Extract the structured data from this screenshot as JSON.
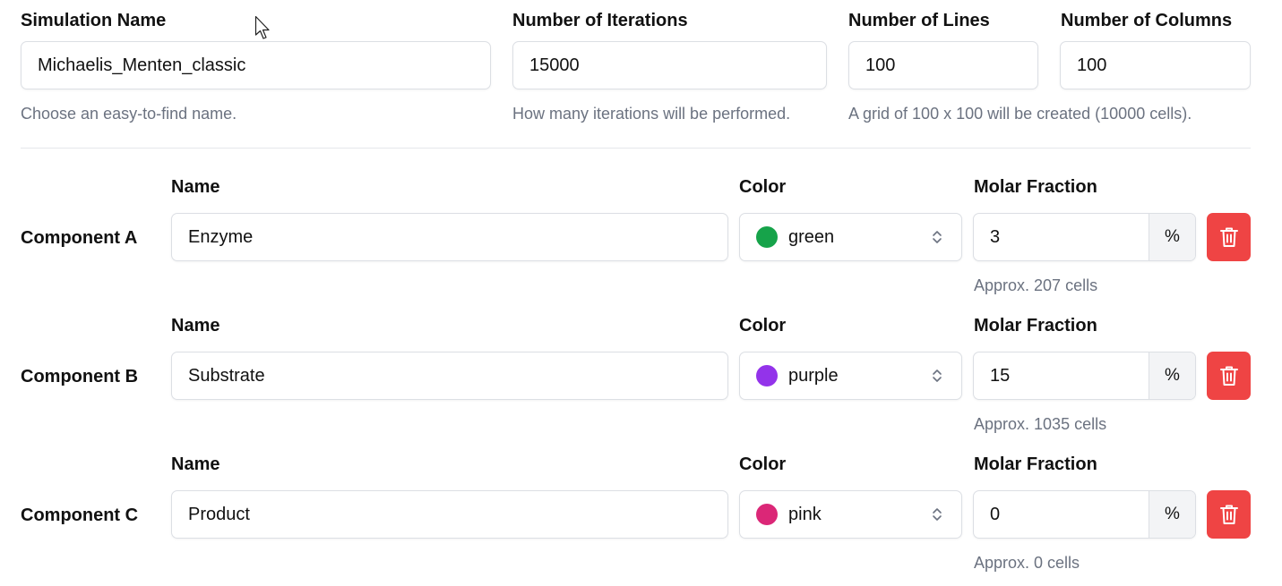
{
  "settings": {
    "simulation_name": {
      "label": "Simulation Name",
      "value": "Michaelis_Menten_classic",
      "help": "Choose an easy-to-find name."
    },
    "iterations": {
      "label": "Number of Iterations",
      "value": "15000",
      "help": "How many iterations will be performed."
    },
    "lines": {
      "label": "Number of Lines",
      "value": "100",
      "help": "A grid of 100 x 100 will be created (10000 cells)."
    },
    "columns": {
      "label": "Number of Columns",
      "value": "100"
    }
  },
  "components": [
    {
      "title": "Component A",
      "name_label": "Name",
      "name": "Enzyme",
      "color_label": "Color",
      "color": "green",
      "color_hex": "#16a34a",
      "fraction_label": "Molar Fraction",
      "fraction": "3",
      "unit": "%",
      "approx": "Approx. 207 cells"
    },
    {
      "title": "Component B",
      "name_label": "Name",
      "name": "Substrate",
      "color_label": "Color",
      "color": "purple",
      "color_hex": "#9333ea",
      "fraction_label": "Molar Fraction",
      "fraction": "15",
      "unit": "%",
      "approx": "Approx. 1035 cells"
    },
    {
      "title": "Component C",
      "name_label": "Name",
      "name": "Product",
      "color_label": "Color",
      "color": "pink",
      "color_hex": "#db2777",
      "fraction_label": "Molar Fraction",
      "fraction": "0",
      "unit": "%",
      "approx": "Approx. 0 cells"
    }
  ],
  "colors": {
    "delete": "#ef4444",
    "border": "#dcdfe4",
    "help_text": "#6b7280"
  },
  "icons": {
    "delete": "trash-icon",
    "select": "chevron-up-down-icon",
    "cursor": "mouse-cursor-icon"
  }
}
